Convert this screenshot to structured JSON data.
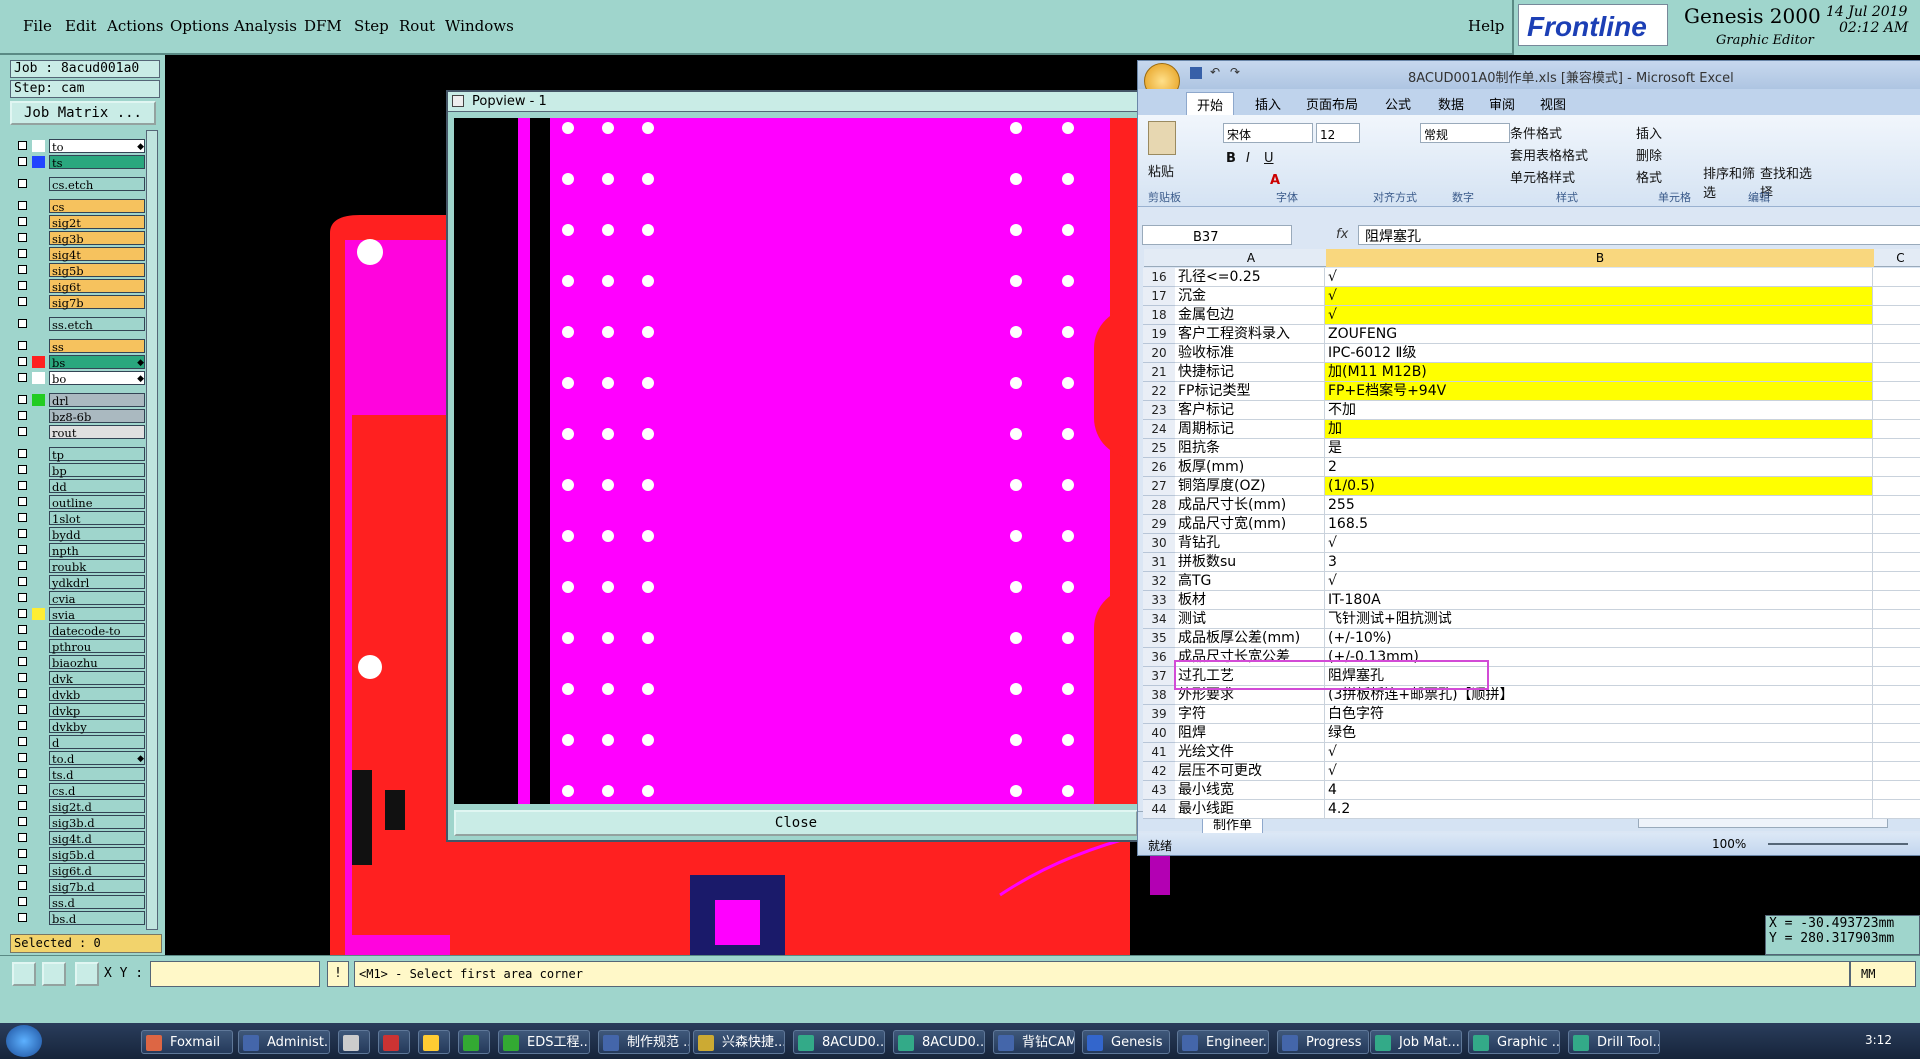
{
  "menu": {
    "items": [
      "File",
      "Edit",
      "Actions",
      "Options",
      "Analysis",
      "DFM",
      "Step",
      "Rout",
      "Windows"
    ],
    "help": "Help"
  },
  "brand": {
    "logo_text": "Frontline",
    "product": "Genesis 2000",
    "subtitle": "Graphic Editor",
    "date": "14 Jul 2019",
    "time": "02:12 AM"
  },
  "job": {
    "job_label": "Job : 8acud001a0",
    "step_label": "Step: cam",
    "matrix_button": "Job Matrix ..."
  },
  "layers": [
    {
      "name": "to",
      "color": "#ffffff",
      "swatch": "#ffffff",
      "mark": true
    },
    {
      "name": "ts",
      "color": "#2aa77e",
      "swatch": "#2244ff"
    },
    {
      "name": "cs.etch",
      "color": "#9fd5cc",
      "swatch": "#9fd5cc"
    },
    {
      "name": "cs",
      "color": "#f6c25e",
      "swatch": "#9fd5cc"
    },
    {
      "name": "sig2t",
      "color": "#f6c25e",
      "swatch": "#9fd5cc"
    },
    {
      "name": "sig3b",
      "color": "#f6c25e",
      "swatch": "#9fd5cc"
    },
    {
      "name": "sig4t",
      "color": "#f6c25e",
      "swatch": "#9fd5cc"
    },
    {
      "name": "sig5b",
      "color": "#f6c25e",
      "swatch": "#9fd5cc"
    },
    {
      "name": "sig6t",
      "color": "#f6c25e",
      "swatch": "#9fd5cc"
    },
    {
      "name": "sig7b",
      "color": "#f6c25e",
      "swatch": "#9fd5cc"
    },
    {
      "name": "ss.etch",
      "color": "#9fd5cc",
      "swatch": "#9fd5cc"
    },
    {
      "name": "ss",
      "color": "#f6c25e",
      "swatch": "#9fd5cc"
    },
    {
      "name": "bs",
      "color": "#2aa77e",
      "swatch": "#ff2020",
      "mark": true
    },
    {
      "name": "bo",
      "color": "#ffffff",
      "swatch": "#ffffff",
      "mark": true
    },
    {
      "name": "drl",
      "color": "#aab9c0",
      "swatch": "#22cc22"
    },
    {
      "name": "bz8-6b",
      "color": "#aab9c0",
      "swatch": "#9fd5cc"
    },
    {
      "name": "rout",
      "color": "#e0e0e0",
      "swatch": "#9fd5cc"
    },
    {
      "name": "tp",
      "color": "#9fd5cc",
      "swatch": "#9fd5cc"
    },
    {
      "name": "bp",
      "color": "#9fd5cc",
      "swatch": "#9fd5cc"
    },
    {
      "name": "dd",
      "color": "#9fd5cc",
      "swatch": "#9fd5cc"
    },
    {
      "name": "outline",
      "color": "#9fd5cc",
      "swatch": "#9fd5cc"
    },
    {
      "name": "1slot",
      "color": "#9fd5cc",
      "swatch": "#9fd5cc"
    },
    {
      "name": "bydd",
      "color": "#9fd5cc",
      "swatch": "#9fd5cc"
    },
    {
      "name": "npth",
      "color": "#9fd5cc",
      "swatch": "#9fd5cc"
    },
    {
      "name": "roubk",
      "color": "#9fd5cc",
      "swatch": "#9fd5cc"
    },
    {
      "name": "ydkdrl",
      "color": "#9fd5cc",
      "swatch": "#9fd5cc"
    },
    {
      "name": "cvia",
      "color": "#9fd5cc",
      "swatch": "#9fd5cc"
    },
    {
      "name": "svia",
      "color": "#9fd5cc",
      "swatch": "#ffee33"
    },
    {
      "name": "datecode-to",
      "color": "#9fd5cc",
      "swatch": "#9fd5cc"
    },
    {
      "name": "pthrou",
      "color": "#9fd5cc",
      "swatch": "#9fd5cc"
    },
    {
      "name": "biaozhu",
      "color": "#9fd5cc",
      "swatch": "#9fd5cc"
    },
    {
      "name": "dvk",
      "color": "#9fd5cc",
      "swatch": "#9fd5cc"
    },
    {
      "name": "dvkb",
      "color": "#9fd5cc",
      "swatch": "#9fd5cc"
    },
    {
      "name": "dvkp",
      "color": "#9fd5cc",
      "swatch": "#9fd5cc"
    },
    {
      "name": "dvkby",
      "color": "#9fd5cc",
      "swatch": "#9fd5cc"
    },
    {
      "name": "d",
      "color": "#9fd5cc",
      "swatch": "#9fd5cc"
    },
    {
      "name": "to.d",
      "color": "#9fd5cc",
      "swatch": "#9fd5cc",
      "mark": true
    },
    {
      "name": "ts.d",
      "color": "#9fd5cc",
      "swatch": "#9fd5cc"
    },
    {
      "name": "cs.d",
      "color": "#9fd5cc",
      "swatch": "#9fd5cc"
    },
    {
      "name": "sig2t.d",
      "color": "#9fd5cc",
      "swatch": "#9fd5cc"
    },
    {
      "name": "sig3b.d",
      "color": "#9fd5cc",
      "swatch": "#9fd5cc"
    },
    {
      "name": "sig4t.d",
      "color": "#9fd5cc",
      "swatch": "#9fd5cc"
    },
    {
      "name": "sig5b.d",
      "color": "#9fd5cc",
      "swatch": "#9fd5cc"
    },
    {
      "name": "sig6t.d",
      "color": "#9fd5cc",
      "swatch": "#9fd5cc"
    },
    {
      "name": "sig7b.d",
      "color": "#9fd5cc",
      "swatch": "#9fd5cc"
    },
    {
      "name": "ss.d",
      "color": "#9fd5cc",
      "swatch": "#9fd5cc"
    },
    {
      "name": "bs.d",
      "color": "#9fd5cc",
      "swatch": "#9fd5cc"
    }
  ],
  "selected_label": "Selected : 0",
  "popview": {
    "title": "Popview - 1",
    "close": "Close"
  },
  "status": {
    "xy_label": "X Y :",
    "xy_value": "",
    "prompt": "<M1> - Select first area corner",
    "units": "MM",
    "coord_x": "X = -30.493723mm",
    "coord_y": "Y = 280.317903mm"
  },
  "excel": {
    "title": "8ACUD001A0制作单.xls  [兼容模式]  - Microsoft Excel",
    "tabs": [
      "开始",
      "插入",
      "页面布局",
      "公式",
      "数据",
      "审阅",
      "视图"
    ],
    "font_name": "宋体",
    "font_size": "12",
    "number_format": "常规",
    "groups": [
      "剪贴板",
      "字体",
      "对齐方式",
      "数字",
      "样式",
      "单元格",
      "编辑"
    ],
    "paste": "粘贴",
    "styles": [
      "条件格式",
      "套用表格格式",
      "单元格样式"
    ],
    "cells": [
      "插入",
      "删除",
      "格式"
    ],
    "edit": [
      "排序和筛选",
      "查找和选择"
    ],
    "name_box": "B37",
    "formula": "阻焊塞孔",
    "col_headers": [
      "A",
      "B",
      "C"
    ],
    "rows": [
      {
        "n": "16",
        "a": "孔径<=0.25",
        "b": "√",
        "y": false
      },
      {
        "n": "17",
        "a": "沉金",
        "b": "√",
        "y": true
      },
      {
        "n": "18",
        "a": "金属包边",
        "b": "√",
        "y": true
      },
      {
        "n": "19",
        "a": "客户工程资料录入",
        "b": "ZOUFENG",
        "y": false
      },
      {
        "n": "20",
        "a": "验收标准",
        "b": "IPC-6012 Ⅱ级",
        "y": false
      },
      {
        "n": "21",
        "a": "快捷标记",
        "b": "加(M11 M12B)",
        "y": true
      },
      {
        "n": "22",
        "a": "FP标记类型",
        "b": "FP+E档案号+94V",
        "y": true
      },
      {
        "n": "23",
        "a": "客户标记",
        "b": "不加",
        "y": false
      },
      {
        "n": "24",
        "a": "周期标记",
        "b": "加",
        "y": true
      },
      {
        "n": "25",
        "a": "阻抗条",
        "b": "是",
        "y": false
      },
      {
        "n": "26",
        "a": "板厚(mm)",
        "b": "2",
        "y": false
      },
      {
        "n": "27",
        "a": "铜箔厚度(OZ)",
        "b": "(1/0.5)",
        "y": true
      },
      {
        "n": "28",
        "a": "成品尺寸长(mm)",
        "b": "255",
        "y": false
      },
      {
        "n": "29",
        "a": "成品尺寸宽(mm)",
        "b": "168.5",
        "y": false
      },
      {
        "n": "30",
        "a": "背钻孔",
        "b": "√",
        "y": false
      },
      {
        "n": "31",
        "a": "拼板数su",
        "b": "3",
        "y": false
      },
      {
        "n": "32",
        "a": "高TG",
        "b": "√",
        "y": false
      },
      {
        "n": "33",
        "a": "板材",
        "b": "IT-180A",
        "y": false
      },
      {
        "n": "34",
        "a": "测试",
        "b": "飞针测试+阻抗测试",
        "y": false
      },
      {
        "n": "35",
        "a": "成品板厚公差(mm)",
        "b": "(+/-10%)",
        "y": false
      },
      {
        "n": "36",
        "a": "成品尺寸长宽公差",
        "b": "(+/-0.13mm)",
        "y": false
      },
      {
        "n": "37",
        "a": "过孔工艺",
        "b": "阻焊塞孔",
        "y": false
      },
      {
        "n": "38",
        "a": "外形要求",
        "b": "(3拼板桥连+邮票孔)【顺拼】",
        "y": false
      },
      {
        "n": "39",
        "a": "字符",
        "b": "白色字符",
        "y": false
      },
      {
        "n": "40",
        "a": "阻焊",
        "b": "绿色",
        "y": false
      },
      {
        "n": "41",
        "a": "光绘文件",
        "b": "√",
        "y": false
      },
      {
        "n": "42",
        "a": "层压不可更改",
        "b": "√",
        "y": false
      },
      {
        "n": "43",
        "a": "最小线宽",
        "b": "4",
        "y": false
      },
      {
        "n": "44",
        "a": "最小线距",
        "b": "4.2",
        "y": false
      }
    ],
    "sheet_tab": "制作单",
    "ready": "就绪",
    "zoom": "100%"
  },
  "taskbar": {
    "items": [
      "Foxmail",
      "Administ...",
      "",
      "",
      "",
      "",
      "EDS工程...",
      "制作规范 ...",
      "兴森快捷...",
      "8ACUD0...",
      "8ACUD0...",
      "背钻CAM...",
      "Genesis",
      "Engineer...",
      "Progress",
      "Job Mat...",
      "Graphic ...",
      "Drill Tool..."
    ],
    "clock": "3:12"
  }
}
